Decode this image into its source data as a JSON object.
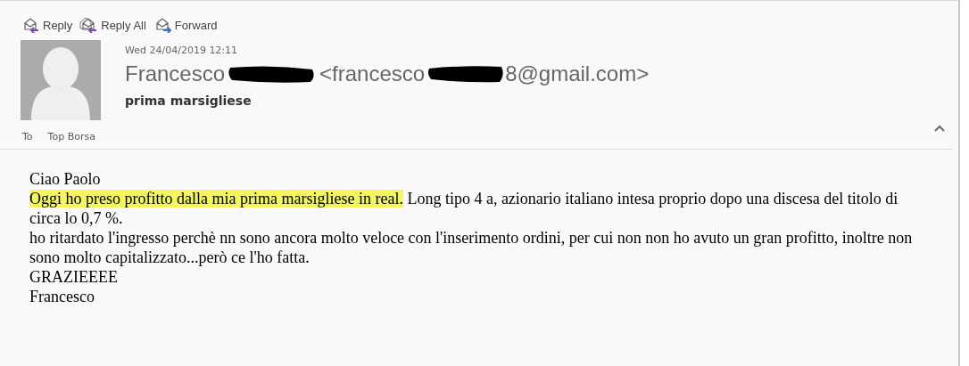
{
  "toolbar": [
    {
      "label": "Reply",
      "kind": "reply"
    },
    {
      "label": "Reply All",
      "kind": "reply_all"
    },
    {
      "label": "Forward",
      "kind": "forward"
    }
  ],
  "message": {
    "date": "Wed 24/04/2019 12:11",
    "sender_name": "Francesco",
    "sender_address_start": "<francesco",
    "sender_address_end": "8@gmail.com>",
    "subject": "prima marsigliese",
    "to_label": "To",
    "to": "Top Borsa"
  },
  "body": [
    {
      "segments": [
        {
          "text": "Ciao Paolo",
          "highlighted": false
        }
      ]
    },
    {
      "segments": [
        {
          "text": "Oggi ho preso profitto dalla mia prima marsigliese in real.",
          "highlighted": true
        },
        {
          "text": " Long tipo 4 a, azionario italiano intesa proprio dopo una discesa del titolo di circa lo 0,7 %.",
          "highlighted": false
        }
      ]
    },
    {
      "segments": [
        {
          "text": "ho ritardato l'ingresso perchè nn sono ancora molto veloce con l'inserimento ordini, per cui non non ho avuto un gran profitto, inoltre non sono molto capitalizzato...però ce l'ho fatta.",
          "highlighted": false
        }
      ]
    },
    {
      "segments": [
        {
          "text": "GRAZIEEEE",
          "highlighted": false
        }
      ]
    },
    {
      "segments": [
        {
          "text": "Francesco",
          "highlighted": false
        }
      ]
    }
  ]
}
